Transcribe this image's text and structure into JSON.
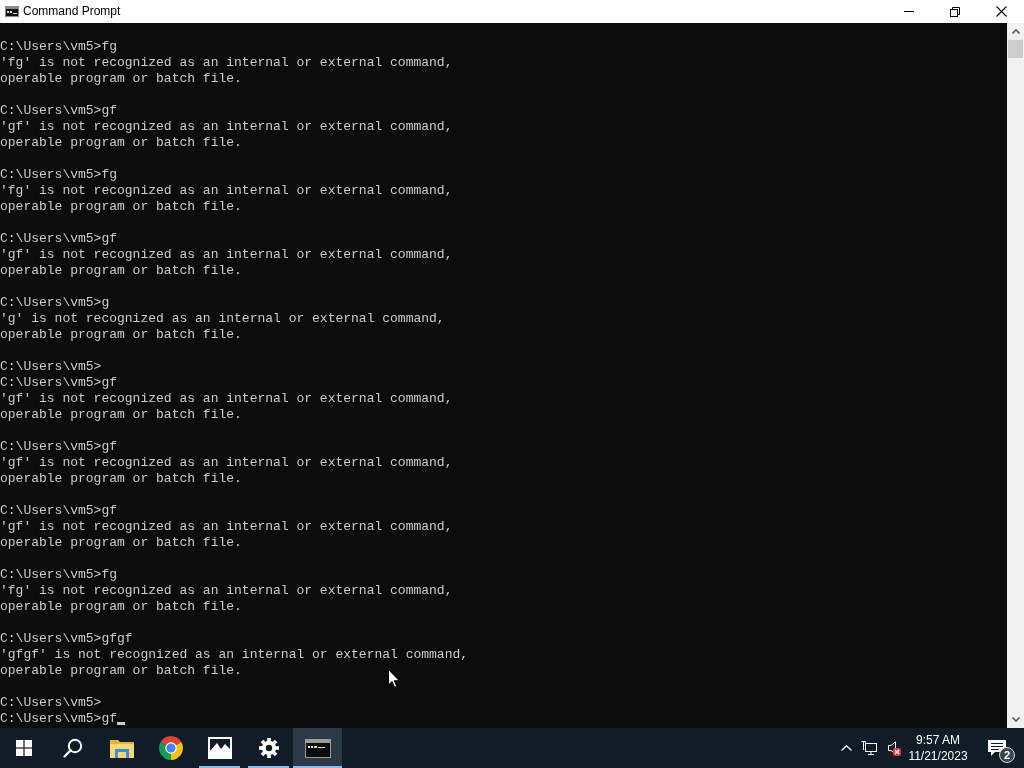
{
  "window": {
    "title": "Command Prompt"
  },
  "console": {
    "blocks": [
      [
        "C:\\Users\\vm5>fg",
        "'fg' is not recognized as an internal or external command,",
        "operable program or batch file."
      ],
      [
        "C:\\Users\\vm5>gf",
        "'gf' is not recognized as an internal or external command,",
        "operable program or batch file."
      ],
      [
        "C:\\Users\\vm5>fg",
        "'fg' is not recognized as an internal or external command,",
        "operable program or batch file."
      ],
      [
        "C:\\Users\\vm5>gf",
        "'gf' is not recognized as an internal or external command,",
        "operable program or batch file."
      ],
      [
        "C:\\Users\\vm5>g",
        "'g' is not recognized as an internal or external command,",
        "operable program or batch file."
      ],
      [
        "C:\\Users\\vm5>",
        "C:\\Users\\vm5>gf",
        "'gf' is not recognized as an internal or external command,",
        "operable program or batch file."
      ],
      [
        "C:\\Users\\vm5>gf",
        "'gf' is not recognized as an internal or external command,",
        "operable program or batch file."
      ],
      [
        "C:\\Users\\vm5>gf",
        "'gf' is not recognized as an internal or external command,",
        "operable program or batch file."
      ],
      [
        "C:\\Users\\vm5>fg",
        "'fg' is not recognized as an internal or external command,",
        "operable program or batch file."
      ],
      [
        "C:\\Users\\vm5>gfgf",
        "'gfgf' is not recognized as an internal or external command,",
        "operable program or batch file."
      ],
      [
        "C:\\Users\\vm5>",
        "C:\\Users\\vm5>gf"
      ]
    ],
    "cursor": true
  },
  "taskbar": {
    "apps": [
      {
        "running": false,
        "selected": false
      },
      {
        "running": false,
        "selected": false
      },
      {
        "running": true,
        "selected": false
      },
      {
        "running": true,
        "selected": false
      },
      {
        "running": true,
        "selected": true
      }
    ]
  },
  "tray": {
    "volume_muted": true,
    "time": "9:57 AM",
    "date": "11/21/2023",
    "notification_count": "2"
  }
}
